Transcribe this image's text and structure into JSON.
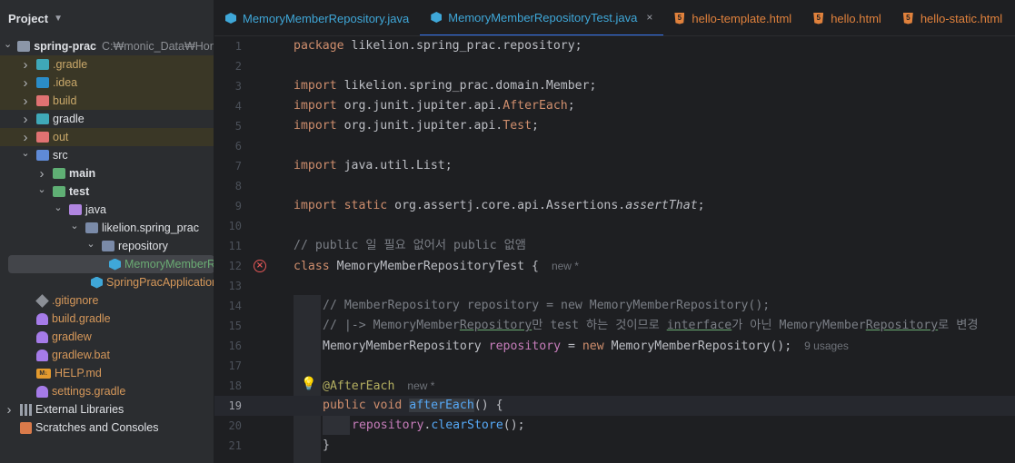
{
  "project": {
    "title": "Project",
    "tree": [
      {
        "label": "spring-prac",
        "path": "C:₩monic_Data₩Hong",
        "depth": 0,
        "arrow": "down",
        "icon": "module-folder-icon",
        "style": "bold"
      },
      {
        "label": ".gradle",
        "depth": 1,
        "arrow": "right",
        "icon": "gradle-folder-icon",
        "style": "excluded"
      },
      {
        "label": ".idea",
        "depth": 1,
        "arrow": "right",
        "icon": "idea-folder-icon",
        "style": "excluded"
      },
      {
        "label": "build",
        "depth": 1,
        "arrow": "right",
        "icon": "excluded-folder-icon",
        "style": "excluded"
      },
      {
        "label": "gradle",
        "depth": 1,
        "arrow": "right",
        "icon": "gradle-folder-icon",
        "style": "normal"
      },
      {
        "label": "out",
        "depth": 1,
        "arrow": "right",
        "icon": "excluded-folder-icon",
        "style": "excluded"
      },
      {
        "label": "src",
        "depth": 1,
        "arrow": "down",
        "icon": "source-root-folder-icon",
        "style": "normal"
      },
      {
        "label": "main",
        "depth": 2,
        "arrow": "right",
        "icon": "folder-icon",
        "style": "bold"
      },
      {
        "label": "test",
        "depth": 2,
        "arrow": "down",
        "icon": "test-folder-icon",
        "style": "bold"
      },
      {
        "label": "java",
        "depth": 3,
        "arrow": "down",
        "icon": "test-source-folder-icon",
        "style": "normal"
      },
      {
        "label": "likelion.spring_prac",
        "depth": 4,
        "arrow": "down",
        "icon": "package-icon",
        "style": "normal"
      },
      {
        "label": "repository",
        "depth": 5,
        "arrow": "down",
        "icon": "package-icon",
        "style": "normal"
      },
      {
        "label": "MemoryMemberRepositoryTest",
        "depth": 6,
        "arrow": "",
        "icon": "java-class-icon",
        "style": "green",
        "selected": true
      },
      {
        "label": "SpringPracApplicationTests",
        "depth": 5,
        "arrow": "",
        "icon": "java-class-icon",
        "style": "orange"
      },
      {
        "label": ".gitignore",
        "depth": 1,
        "arrow": "",
        "icon": "gitignore-icon",
        "style": "orange"
      },
      {
        "label": "build.gradle",
        "depth": 1,
        "arrow": "",
        "icon": "gradle-file-icon",
        "style": "orange"
      },
      {
        "label": "gradlew",
        "depth": 1,
        "arrow": "",
        "icon": "gradle-file-icon",
        "style": "orange"
      },
      {
        "label": "gradlew.bat",
        "depth": 1,
        "arrow": "",
        "icon": "gradle-file-icon",
        "style": "orange"
      },
      {
        "label": "HELP.md",
        "depth": 1,
        "arrow": "",
        "icon": "markdown-icon",
        "style": "orange"
      },
      {
        "label": "settings.gradle",
        "depth": 1,
        "arrow": "",
        "icon": "gradle-file-icon",
        "style": "orange"
      },
      {
        "label": "External Libraries",
        "depth": 0,
        "arrow": "right",
        "icon": "library-icon",
        "style": "normal"
      },
      {
        "label": "Scratches and Consoles",
        "depth": 0,
        "arrow": "",
        "icon": "scratches-icon",
        "style": "normal"
      }
    ]
  },
  "tabs": [
    {
      "label": "MemoryMemberRepository.java",
      "type": "java",
      "active": false
    },
    {
      "label": "MemoryMemberRepositoryTest.java",
      "type": "java",
      "active": true,
      "closable": true
    },
    {
      "label": "hello-template.html",
      "type": "html",
      "active": false
    },
    {
      "label": "hello.html",
      "type": "html",
      "active": false
    },
    {
      "label": "hello-static.html",
      "type": "html",
      "active": false
    }
  ],
  "editor": {
    "current_line": 19,
    "line_numbers": [
      "1",
      "2",
      "3",
      "4",
      "5",
      "6",
      "7",
      "8",
      "9",
      "10",
      "11",
      "12",
      "13",
      "14",
      "15",
      "16",
      "17",
      "18",
      "19",
      "20",
      "21"
    ],
    "lines": {
      "l1": {
        "kw": "package",
        "rest": " likelion.spring_prac.repository;"
      },
      "l3": {
        "kw": "import",
        "rest": " likelion.spring_prac.domain.Member;"
      },
      "l4": {
        "kw": "import",
        "rest_a": " org.junit.jupiter.api.",
        "ann": "AfterEach",
        "rest_b": ";"
      },
      "l5": {
        "kw": "import",
        "rest_a": " org.junit.jupiter.api.",
        "ann": "Test",
        "rest_b": ";"
      },
      "l7": {
        "kw": "import",
        "rest": " java.util.List;"
      },
      "l9": {
        "kw": "import static",
        "rest": " org.assertj.core.api.Assertions.",
        "it": "assertThat",
        "rest_b": ";"
      },
      "l11": {
        "comment": "// public 일 필요 없어서 public 없앰"
      },
      "l12": {
        "kw": "class",
        "rest": " MemoryMemberRepositoryTest {",
        "hint": "new *"
      },
      "l14": {
        "comment": "// MemberRepository repository = new MemoryMemberRepository();"
      },
      "l15": {
        "c1": "// |-> MemoryMember",
        "c2": "Repository",
        "c3": "만 test 하는 것이므로 ",
        "c4": "interface",
        "c5": "가 아닌 MemoryMember",
        "c6": "Repository",
        "c7": "로 변경"
      },
      "l16": {
        "type": "MemoryMemberRepository",
        "field": "repository",
        "eq": " = ",
        "kw": "new",
        "ctor": " MemoryMemberRepository",
        "end": "();",
        "hint": "9 usages"
      },
      "l18": {
        "ann": "@AfterEach",
        "hint": "new *"
      },
      "l19": {
        "kw": "public void",
        "sp": " ",
        "method": "afterEach",
        "end": "() {"
      },
      "l20": {
        "field": "repository",
        "dot": ".",
        "call": "clearStore",
        "end": "();"
      },
      "l21": {
        "brace": "}"
      }
    }
  }
}
